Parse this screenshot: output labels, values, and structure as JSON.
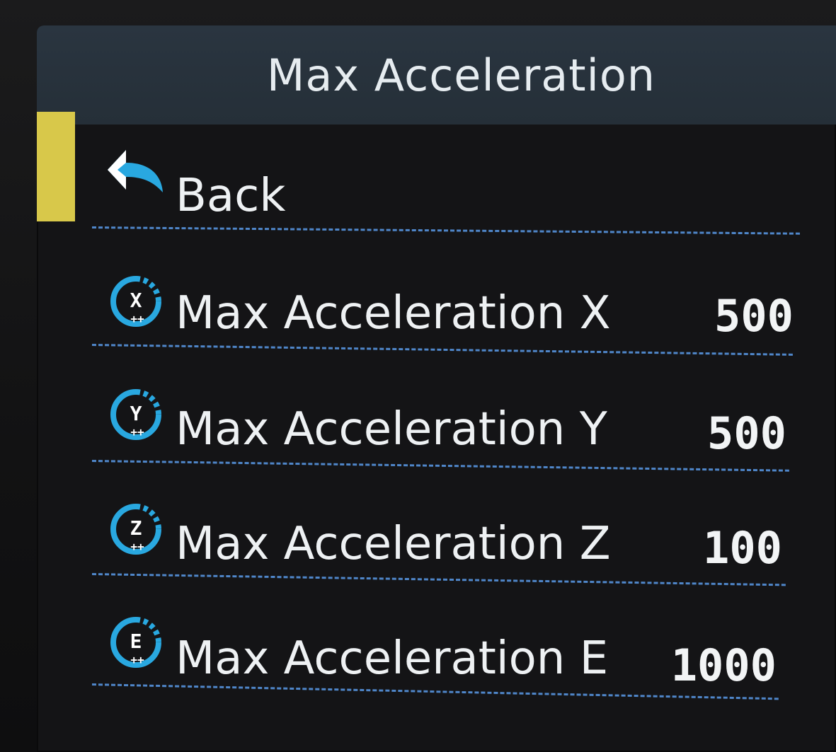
{
  "header": {
    "title": "Max Acceleration"
  },
  "colors": {
    "selection": "#d8c84a",
    "accent": "#29a8e0",
    "divider": "#4f86c9",
    "title_bar": "#2a3540"
  },
  "menu": {
    "back": {
      "label": "Back",
      "icon": "back-arrow-icon",
      "selected": true
    },
    "items": [
      {
        "label": "Max Acceleration X",
        "value": "500",
        "icon": "x-axis-icon",
        "glyph": "X"
      },
      {
        "label": "Max Acceleration Y",
        "value": "500",
        "icon": "y-axis-icon",
        "glyph": "Y"
      },
      {
        "label": "Max Acceleration Z",
        "value": "100",
        "icon": "z-axis-icon",
        "glyph": "Z"
      },
      {
        "label": "Max Acceleration E",
        "value": "1000",
        "icon": "extruder-icon",
        "glyph": "E"
      }
    ]
  }
}
